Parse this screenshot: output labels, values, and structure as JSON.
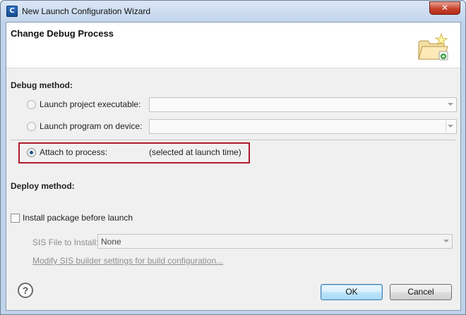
{
  "window": {
    "title": "New Launch Configuration Wizard",
    "close_glyph": "✕",
    "app_icon_glyph": "C"
  },
  "header": {
    "title": "Change Debug Process",
    "icon": "folder-wizard-icon"
  },
  "debug_method": {
    "label": "Debug method:",
    "options": [
      {
        "label": "Launch project executable:",
        "selected": false,
        "dropdown_value": ""
      },
      {
        "label": "Launch program on device:",
        "selected": false,
        "dropdown_value": ""
      },
      {
        "label": "Attach to process:",
        "selected": true,
        "note": "(selected at launch time)"
      }
    ]
  },
  "deploy_method": {
    "label": "Deploy method:",
    "install_checkbox": {
      "label": "Install package before launch",
      "checked": false
    },
    "sis_file": {
      "label": "SIS File to Install:",
      "value": "None"
    },
    "modify_link": "Modify SIS builder settings for build configuration..."
  },
  "footer": {
    "help_glyph": "?",
    "ok_label": "OK",
    "cancel_label": "Cancel"
  },
  "colors": {
    "highlight_border": "#b01c2c",
    "title_bar": "#c2d5ec",
    "client_bg": "#f0f0f0"
  }
}
